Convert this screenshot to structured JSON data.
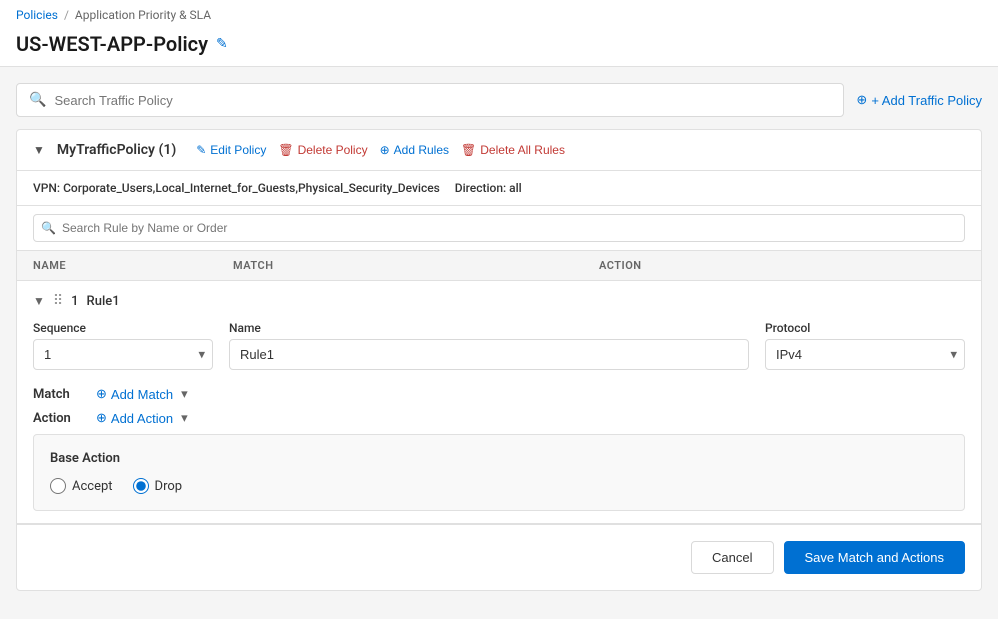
{
  "breadcrumb": {
    "parent": "Policies",
    "current": "Application Priority & SLA"
  },
  "page": {
    "title": "US-WEST-APP-Policy",
    "edit_icon": "✎"
  },
  "global_search": {
    "placeholder": "Search Traffic Policy"
  },
  "add_traffic_policy_btn": "+ Add Traffic Policy",
  "policy": {
    "name": "MyTrafficPolicy",
    "count": "(1)",
    "edit_label": "Edit Policy",
    "delete_label": "Delete Policy",
    "add_rules_label": "Add Rules",
    "delete_all_label": "Delete All Rules",
    "vpn_label": "VPN:",
    "vpn_value": "Corporate_Users,Local_Internet_for_Guests,Physical_Security_Devices",
    "direction_label": "Direction:",
    "direction_value": "all"
  },
  "rule_search": {
    "placeholder": "Search Rule by Name or Order"
  },
  "table": {
    "col_name": "NAME",
    "col_match": "MATCH",
    "col_action": "ACTION"
  },
  "rule": {
    "number": "1",
    "name": "Rule1",
    "sequence_label": "Sequence",
    "sequence_value": "1",
    "name_label": "Name",
    "name_value": "Rule1",
    "protocol_label": "Protocol",
    "protocol_value": "IPv4",
    "match_label": "Match",
    "add_match_label": "Add Match",
    "action_label": "Action",
    "add_action_label": "Add Action",
    "base_action_title": "Base Action",
    "accept_label": "Accept",
    "drop_label": "Drop",
    "selected_base_action": "drop"
  },
  "footer": {
    "cancel_label": "Cancel",
    "save_label": "Save Match and Actions"
  }
}
